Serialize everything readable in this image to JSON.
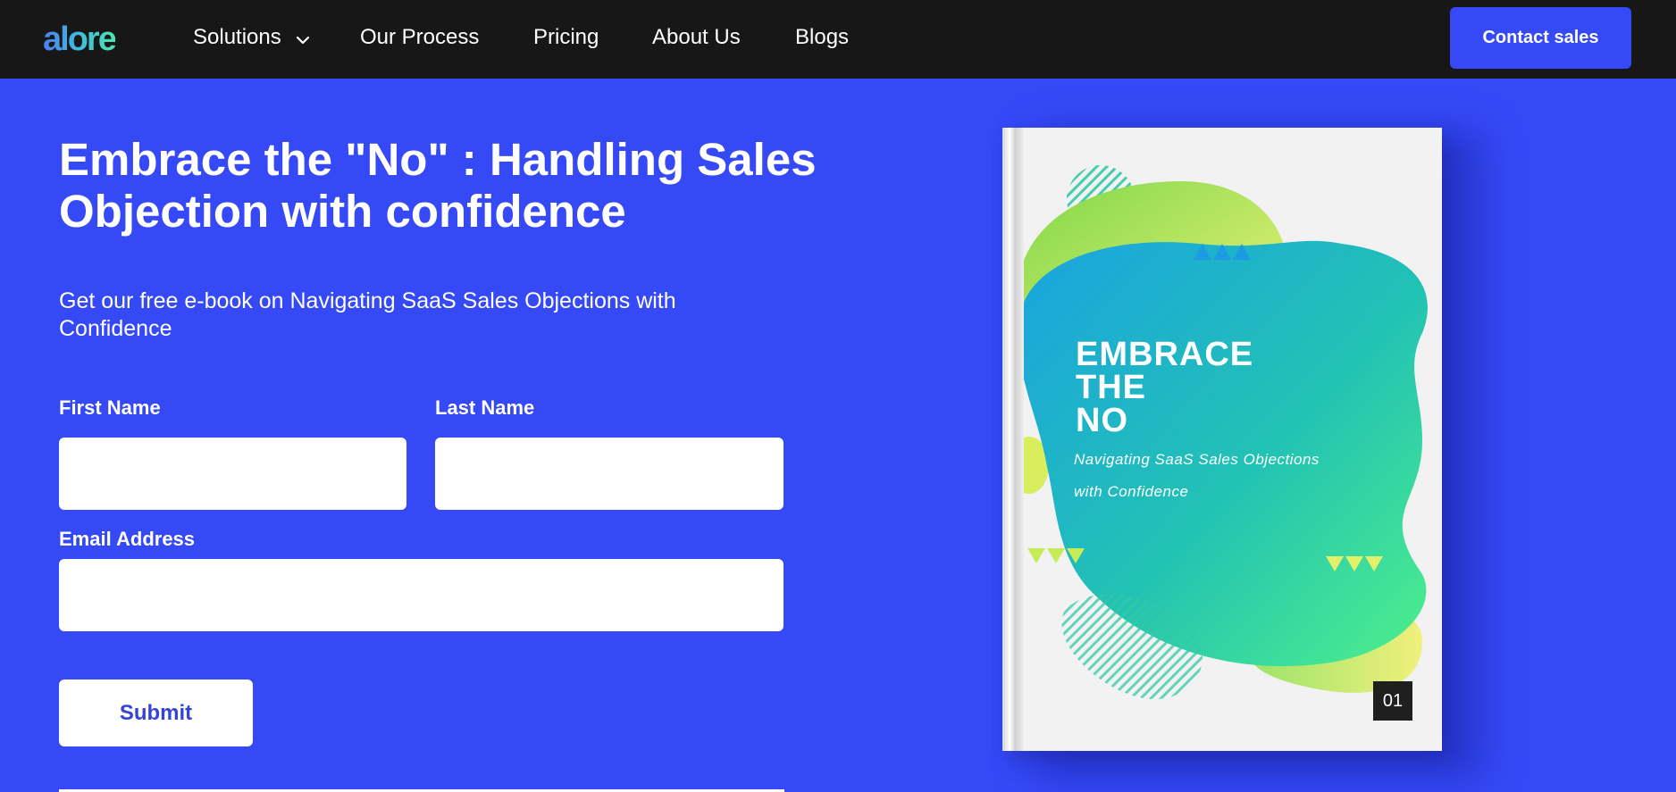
{
  "nav": {
    "logo": "alore",
    "items": [
      {
        "label": "Solutions",
        "has_dropdown": true
      },
      {
        "label": "Our Process"
      },
      {
        "label": "Pricing"
      },
      {
        "label": "About Us"
      },
      {
        "label": "Blogs"
      }
    ],
    "cta_label": "Contact sales"
  },
  "hero": {
    "title": "Embrace the \"No\" : Handling Sales Objection with confidence",
    "subtitle": "Get our free e-book on Navigating SaaS Sales Objections with Confidence"
  },
  "form": {
    "first_name_label": "First Name",
    "first_name_value": "",
    "last_name_label": "Last Name",
    "last_name_value": "",
    "email_label": "Email Address",
    "email_value": "",
    "submit_label": "Submit"
  },
  "book": {
    "title_line1": "EMBRACE",
    "title_line2": "THE",
    "title_line3": "NO",
    "subtitle": "Navigating SaaS Sales Objections with Confidence",
    "number": "01"
  },
  "colors": {
    "background": "#3549f7",
    "nav_background": "#171717",
    "button": "#3549f7",
    "submit_text": "#3444d4"
  }
}
